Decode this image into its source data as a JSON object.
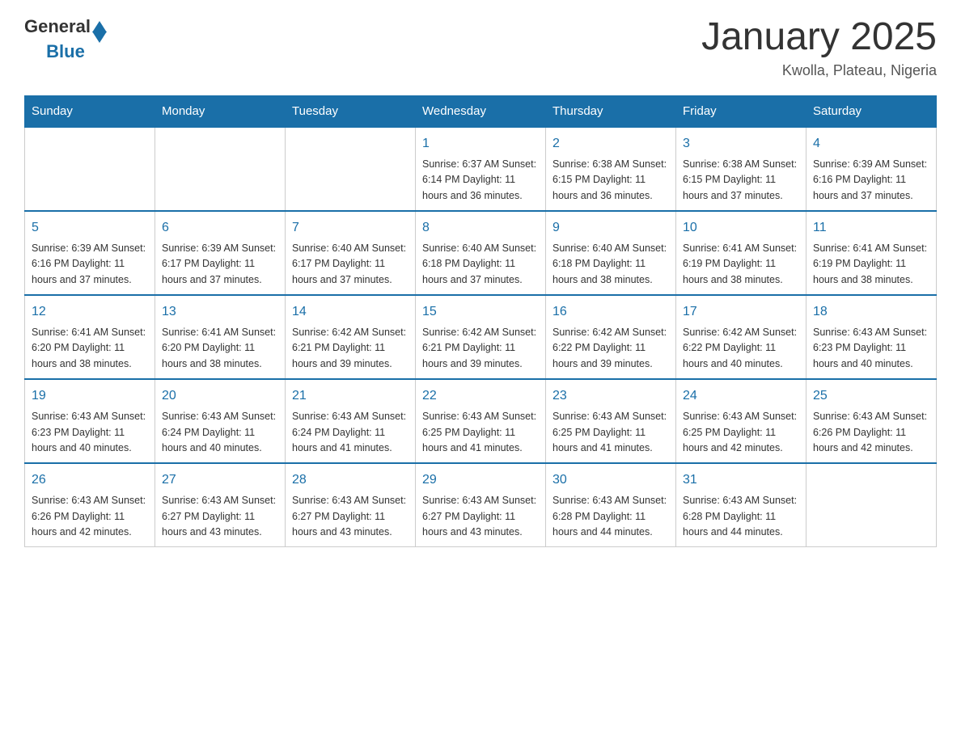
{
  "header": {
    "logo": {
      "general": "General",
      "blue": "Blue"
    },
    "title": "January 2025",
    "subtitle": "Kwolla, Plateau, Nigeria"
  },
  "days_of_week": [
    "Sunday",
    "Monday",
    "Tuesday",
    "Wednesday",
    "Thursday",
    "Friday",
    "Saturday"
  ],
  "weeks": [
    [
      {
        "day": "",
        "info": ""
      },
      {
        "day": "",
        "info": ""
      },
      {
        "day": "",
        "info": ""
      },
      {
        "day": "1",
        "info": "Sunrise: 6:37 AM\nSunset: 6:14 PM\nDaylight: 11 hours and 36 minutes."
      },
      {
        "day": "2",
        "info": "Sunrise: 6:38 AM\nSunset: 6:15 PM\nDaylight: 11 hours and 36 minutes."
      },
      {
        "day": "3",
        "info": "Sunrise: 6:38 AM\nSunset: 6:15 PM\nDaylight: 11 hours and 37 minutes."
      },
      {
        "day": "4",
        "info": "Sunrise: 6:39 AM\nSunset: 6:16 PM\nDaylight: 11 hours and 37 minutes."
      }
    ],
    [
      {
        "day": "5",
        "info": "Sunrise: 6:39 AM\nSunset: 6:16 PM\nDaylight: 11 hours and 37 minutes."
      },
      {
        "day": "6",
        "info": "Sunrise: 6:39 AM\nSunset: 6:17 PM\nDaylight: 11 hours and 37 minutes."
      },
      {
        "day": "7",
        "info": "Sunrise: 6:40 AM\nSunset: 6:17 PM\nDaylight: 11 hours and 37 minutes."
      },
      {
        "day": "8",
        "info": "Sunrise: 6:40 AM\nSunset: 6:18 PM\nDaylight: 11 hours and 37 minutes."
      },
      {
        "day": "9",
        "info": "Sunrise: 6:40 AM\nSunset: 6:18 PM\nDaylight: 11 hours and 38 minutes."
      },
      {
        "day": "10",
        "info": "Sunrise: 6:41 AM\nSunset: 6:19 PM\nDaylight: 11 hours and 38 minutes."
      },
      {
        "day": "11",
        "info": "Sunrise: 6:41 AM\nSunset: 6:19 PM\nDaylight: 11 hours and 38 minutes."
      }
    ],
    [
      {
        "day": "12",
        "info": "Sunrise: 6:41 AM\nSunset: 6:20 PM\nDaylight: 11 hours and 38 minutes."
      },
      {
        "day": "13",
        "info": "Sunrise: 6:41 AM\nSunset: 6:20 PM\nDaylight: 11 hours and 38 minutes."
      },
      {
        "day": "14",
        "info": "Sunrise: 6:42 AM\nSunset: 6:21 PM\nDaylight: 11 hours and 39 minutes."
      },
      {
        "day": "15",
        "info": "Sunrise: 6:42 AM\nSunset: 6:21 PM\nDaylight: 11 hours and 39 minutes."
      },
      {
        "day": "16",
        "info": "Sunrise: 6:42 AM\nSunset: 6:22 PM\nDaylight: 11 hours and 39 minutes."
      },
      {
        "day": "17",
        "info": "Sunrise: 6:42 AM\nSunset: 6:22 PM\nDaylight: 11 hours and 40 minutes."
      },
      {
        "day": "18",
        "info": "Sunrise: 6:43 AM\nSunset: 6:23 PM\nDaylight: 11 hours and 40 minutes."
      }
    ],
    [
      {
        "day": "19",
        "info": "Sunrise: 6:43 AM\nSunset: 6:23 PM\nDaylight: 11 hours and 40 minutes."
      },
      {
        "day": "20",
        "info": "Sunrise: 6:43 AM\nSunset: 6:24 PM\nDaylight: 11 hours and 40 minutes."
      },
      {
        "day": "21",
        "info": "Sunrise: 6:43 AM\nSunset: 6:24 PM\nDaylight: 11 hours and 41 minutes."
      },
      {
        "day": "22",
        "info": "Sunrise: 6:43 AM\nSunset: 6:25 PM\nDaylight: 11 hours and 41 minutes."
      },
      {
        "day": "23",
        "info": "Sunrise: 6:43 AM\nSunset: 6:25 PM\nDaylight: 11 hours and 41 minutes."
      },
      {
        "day": "24",
        "info": "Sunrise: 6:43 AM\nSunset: 6:25 PM\nDaylight: 11 hours and 42 minutes."
      },
      {
        "day": "25",
        "info": "Sunrise: 6:43 AM\nSunset: 6:26 PM\nDaylight: 11 hours and 42 minutes."
      }
    ],
    [
      {
        "day": "26",
        "info": "Sunrise: 6:43 AM\nSunset: 6:26 PM\nDaylight: 11 hours and 42 minutes."
      },
      {
        "day": "27",
        "info": "Sunrise: 6:43 AM\nSunset: 6:27 PM\nDaylight: 11 hours and 43 minutes."
      },
      {
        "day": "28",
        "info": "Sunrise: 6:43 AM\nSunset: 6:27 PM\nDaylight: 11 hours and 43 minutes."
      },
      {
        "day": "29",
        "info": "Sunrise: 6:43 AM\nSunset: 6:27 PM\nDaylight: 11 hours and 43 minutes."
      },
      {
        "day": "30",
        "info": "Sunrise: 6:43 AM\nSunset: 6:28 PM\nDaylight: 11 hours and 44 minutes."
      },
      {
        "day": "31",
        "info": "Sunrise: 6:43 AM\nSunset: 6:28 PM\nDaylight: 11 hours and 44 minutes."
      },
      {
        "day": "",
        "info": ""
      }
    ]
  ]
}
